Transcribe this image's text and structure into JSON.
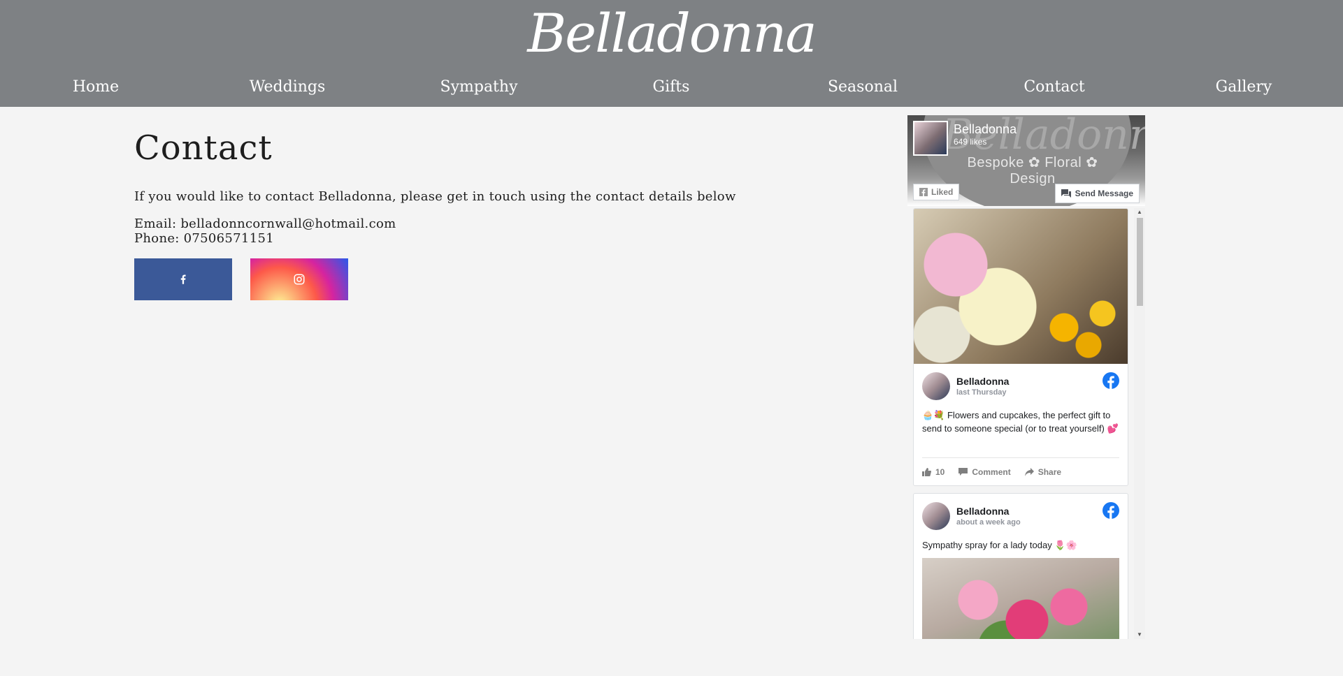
{
  "header": {
    "logo": "Belladonna",
    "nav": [
      "Home",
      "Weddings",
      "Sympathy",
      "Gifts",
      "Seasonal",
      "Contact",
      "Gallery"
    ]
  },
  "main": {
    "title": "Contact",
    "intro": "If you would like to contact Belladonna, please get in touch using the contact details below",
    "email_line": "Email: belladonncornwall@hotmail.com",
    "phone_line": "Phone: 07506571151",
    "social": [
      "facebook-icon",
      "instagram-icon"
    ]
  },
  "facebook_widget": {
    "page_name": "Belladonna",
    "likes": "649 likes",
    "cover_tagline": "Bespoke ✿ Floral ✿ Design",
    "liked_label": "Liked",
    "send_message_label": "Send Message",
    "posts": [
      {
        "author": "Belladonna",
        "time": "last Thursday",
        "text": "🧁💐 Flowers and cupcakes, the perfect gift to send to someone special (or to treat yourself) 💕",
        "likes": "10",
        "comment_label": "Comment",
        "share_label": "Share"
      },
      {
        "author": "Belladonna",
        "time": "about a week ago",
        "text": "Sympathy spray for a lady today 🌷🌸"
      }
    ]
  },
  "colors": {
    "header_bg": "#7e8184",
    "page_bg": "#f4f4f4",
    "facebook_blue": "#3b5998"
  }
}
